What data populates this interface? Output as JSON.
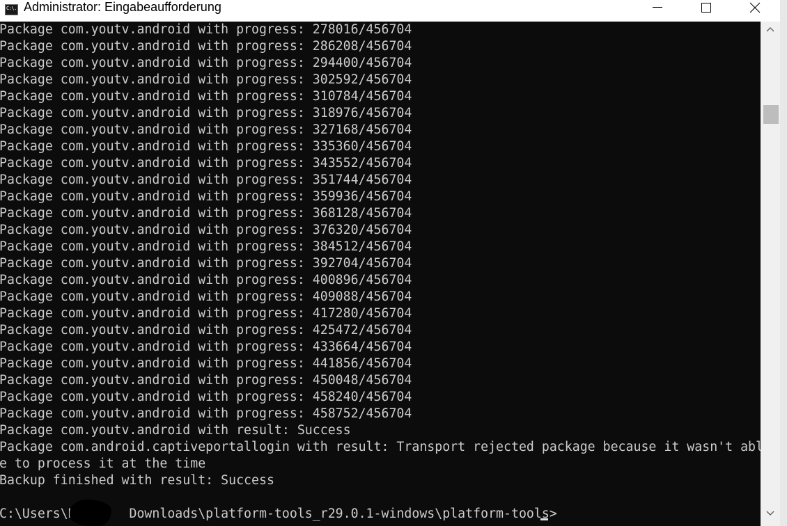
{
  "window": {
    "title": "Administrator: Eingabeaufforderung",
    "icon": "cmd-icon",
    "icon_text": "C:\\.",
    "controls": [
      "minimize-icon",
      "maximize-icon",
      "close-icon"
    ]
  },
  "terminal": {
    "lines": [
      "Package com.youtv.android with progress: 278016/456704",
      "Package com.youtv.android with progress: 286208/456704",
      "Package com.youtv.android with progress: 294400/456704",
      "Package com.youtv.android with progress: 302592/456704",
      "Package com.youtv.android with progress: 310784/456704",
      "Package com.youtv.android with progress: 318976/456704",
      "Package com.youtv.android with progress: 327168/456704",
      "Package com.youtv.android with progress: 335360/456704",
      "Package com.youtv.android with progress: 343552/456704",
      "Package com.youtv.android with progress: 351744/456704",
      "Package com.youtv.android with progress: 359936/456704",
      "Package com.youtv.android with progress: 368128/456704",
      "Package com.youtv.android with progress: 376320/456704",
      "Package com.youtv.android with progress: 384512/456704",
      "Package com.youtv.android with progress: 392704/456704",
      "Package com.youtv.android with progress: 400896/456704",
      "Package com.youtv.android with progress: 409088/456704",
      "Package com.youtv.android with progress: 417280/456704",
      "Package com.youtv.android with progress: 425472/456704",
      "Package com.youtv.android with progress: 433664/456704",
      "Package com.youtv.android with progress: 441856/456704",
      "Package com.youtv.android with progress: 450048/456704",
      "Package com.youtv.android with progress: 458240/456704",
      "Package com.youtv.android with progress: 458752/456704",
      "Package com.youtv.android with result: Success",
      "Package com.android.captiveportallogin with result: Transport rejected package because it wasn't abl",
      "e to process it at the time",
      "Backup finished with result: Success",
      "",
      "C:\\Users\\H       Downloads\\platform-tools_r29.0.1-windows\\platform-tools>"
    ],
    "colors": {
      "background": "#0c0c0c",
      "text": "#cccccc"
    }
  },
  "scrollbar": {
    "up_icon": "scroll-up-arrow-icon",
    "down_icon": "scroll-down-arrow-icon"
  }
}
